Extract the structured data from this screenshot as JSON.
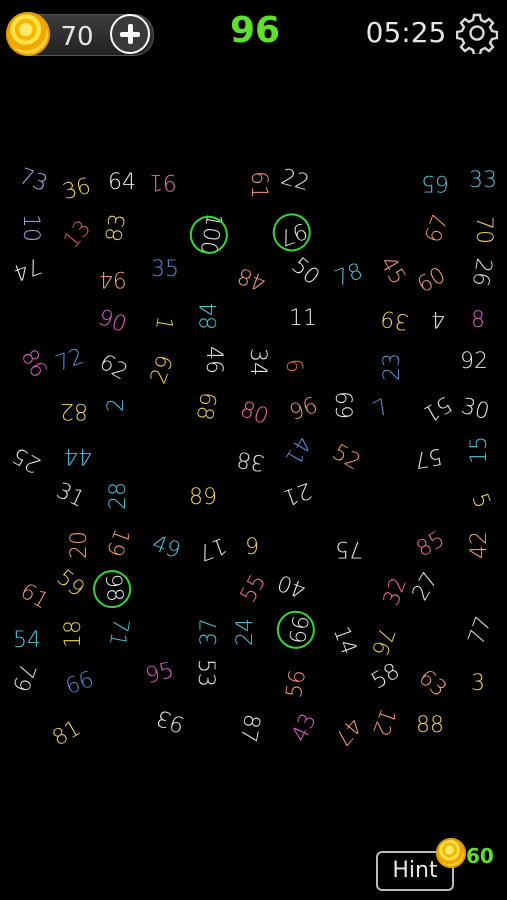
{
  "header": {
    "coins": "70",
    "add_coins_icon": "plus-icon",
    "target_number": "96",
    "timer": "05:25",
    "settings_icon": "gear-icon"
  },
  "footer": {
    "hint_label": "Hint",
    "hint_cost": "60"
  },
  "board": {
    "found_numbers": [
      "100",
      "97",
      "98",
      "99"
    ],
    "numbers": [
      {
        "value": "73",
        "color": "#b69ce8",
        "found": false
      },
      {
        "value": "36",
        "color": "#f0d060",
        "found": false
      },
      {
        "value": "64",
        "color": "#e8e8e8",
        "found": false
      },
      {
        "value": "91",
        "color": "#f06aa8",
        "found": false
      },
      {
        "value": "61",
        "color": "#f59a72",
        "found": false
      },
      {
        "value": "22",
        "color": "#e8e8e8",
        "found": false
      },
      {
        "value": "65",
        "color": "#4ec2d8",
        "found": false
      },
      {
        "value": "33",
        "color": "#4ec2d8",
        "found": false
      },
      {
        "value": "10",
        "color": "#b69ce8",
        "found": false
      },
      {
        "value": "13",
        "color": "#e04a7a",
        "found": false
      },
      {
        "value": "83",
        "color": "#f0d060",
        "found": false
      },
      {
        "value": "100",
        "color": "#e8e8e8",
        "found": true
      },
      {
        "value": "97",
        "color": "#e8e8e8",
        "found": true
      },
      {
        "value": "67",
        "color": "#f59a72",
        "found": false
      },
      {
        "value": "70",
        "color": "#f0d060",
        "found": false
      },
      {
        "value": "74",
        "color": "#e8e8e8",
        "found": false
      },
      {
        "value": "94",
        "color": "#f59a72",
        "found": false
      },
      {
        "value": "35",
        "color": "#5a8ed8",
        "found": false
      },
      {
        "value": "48",
        "color": "#f59a72",
        "found": false
      },
      {
        "value": "50",
        "color": "#e8e8e8",
        "found": false
      },
      {
        "value": "78",
        "color": "#4ec2d8",
        "found": false
      },
      {
        "value": "45",
        "color": "#f59a72",
        "found": false
      },
      {
        "value": "60",
        "color": "#f59a72",
        "found": false
      },
      {
        "value": "26",
        "color": "#e8e8e8",
        "found": false
      },
      {
        "value": "90",
        "color": "#e85ad0",
        "found": false
      },
      {
        "value": "1",
        "color": "#f0d060",
        "found": false
      },
      {
        "value": "84",
        "color": "#4ec2d8",
        "found": false
      },
      {
        "value": "11",
        "color": "#e8e8e8",
        "found": false
      },
      {
        "value": "39",
        "color": "#f0d060",
        "found": false
      },
      {
        "value": "4",
        "color": "#e8e8e8",
        "found": false
      },
      {
        "value": "8",
        "color": "#e85ad0",
        "found": false
      },
      {
        "value": "86",
        "color": "#e85ad0",
        "found": false
      },
      {
        "value": "72",
        "color": "#5a8ed8",
        "found": false
      },
      {
        "value": "62",
        "color": "#e8e8e8",
        "found": false
      },
      {
        "value": "29",
        "color": "#f0d060",
        "found": false
      },
      {
        "value": "46",
        "color": "#e8e8e8",
        "found": false
      },
      {
        "value": "34",
        "color": "#e8e8e8",
        "found": false
      },
      {
        "value": "6",
        "color": "#f06a3a",
        "found": false
      },
      {
        "value": "23",
        "color": "#5a8ed8",
        "found": false
      },
      {
        "value": "92",
        "color": "#e8e8e8",
        "found": false
      },
      {
        "value": "82",
        "color": "#f0d060",
        "found": false
      },
      {
        "value": "2",
        "color": "#4ec2d8",
        "found": false
      },
      {
        "value": "68",
        "color": "#f0d060",
        "found": false
      },
      {
        "value": "80",
        "color": "#f06aa8",
        "found": false
      },
      {
        "value": "96",
        "color": "#f59a72",
        "found": false
      },
      {
        "value": "69",
        "color": "#e8e8e8",
        "found": false
      },
      {
        "value": "7",
        "color": "#5a8ed8",
        "found": false
      },
      {
        "value": "51",
        "color": "#e8e8e8",
        "found": false
      },
      {
        "value": "30",
        "color": "#e8e8e8",
        "found": false
      },
      {
        "value": "25",
        "color": "#e8e8e8",
        "found": false
      },
      {
        "value": "44",
        "color": "#4ec2d8",
        "found": false
      },
      {
        "value": "38",
        "color": "#e8e8e8",
        "found": false
      },
      {
        "value": "41",
        "color": "#5a8ed8",
        "found": false
      },
      {
        "value": "52",
        "color": "#f59a72",
        "found": false
      },
      {
        "value": "57",
        "color": "#e8e8e8",
        "found": false
      },
      {
        "value": "15",
        "color": "#4ec2d8",
        "found": false
      },
      {
        "value": "31",
        "color": "#e8e8e8",
        "found": false
      },
      {
        "value": "28",
        "color": "#4ec2d8",
        "found": false
      },
      {
        "value": "89",
        "color": "#f0d060",
        "found": false
      },
      {
        "value": "21",
        "color": "#e8e8e8",
        "found": false
      },
      {
        "value": "5",
        "color": "#f0d060",
        "found": false
      },
      {
        "value": "20",
        "color": "#f59a72",
        "found": false
      },
      {
        "value": "19",
        "color": "#f59a72",
        "found": false
      },
      {
        "value": "49",
        "color": "#4ec2d8",
        "found": false
      },
      {
        "value": "17",
        "color": "#e8e8e8",
        "found": false
      },
      {
        "value": "9",
        "color": "#f0d060",
        "found": false
      },
      {
        "value": "75",
        "color": "#e8e8e8",
        "found": false
      },
      {
        "value": "85",
        "color": "#f06aa8",
        "found": false
      },
      {
        "value": "42",
        "color": "#f59a72",
        "found": false
      },
      {
        "value": "61",
        "color": "#f59a72",
        "found": false
      },
      {
        "value": "59",
        "color": "#f0d060",
        "found": false
      },
      {
        "value": "98",
        "color": "#e8e8e8",
        "found": true
      },
      {
        "value": "55",
        "color": "#f06aa8",
        "found": false
      },
      {
        "value": "40",
        "color": "#e8e8e8",
        "found": false
      },
      {
        "value": "32",
        "color": "#f06aa8",
        "found": false
      },
      {
        "value": "27",
        "color": "#e8e8e8",
        "found": false
      },
      {
        "value": "54",
        "color": "#4ec2d8",
        "found": false
      },
      {
        "value": "18",
        "color": "#f0d060",
        "found": false
      },
      {
        "value": "71",
        "color": "#4ec2d8",
        "found": false
      },
      {
        "value": "37",
        "color": "#4ec2d8",
        "found": false
      },
      {
        "value": "24",
        "color": "#4ec2d8",
        "found": false
      },
      {
        "value": "99",
        "color": "#e8e8e8",
        "found": true
      },
      {
        "value": "14",
        "color": "#e8e8e8",
        "found": false
      },
      {
        "value": "76",
        "color": "#f0d060",
        "found": false
      },
      {
        "value": "77",
        "color": "#e8e8e8",
        "found": false
      },
      {
        "value": "79",
        "color": "#e8e8e8",
        "found": false
      },
      {
        "value": "66",
        "color": "#5a8ed8",
        "found": false
      },
      {
        "value": "95",
        "color": "#e85ad0",
        "found": false
      },
      {
        "value": "53",
        "color": "#e8e8e8",
        "found": false
      },
      {
        "value": "56",
        "color": "#f59a72",
        "found": false
      },
      {
        "value": "58",
        "color": "#e8e8e8",
        "found": false
      },
      {
        "value": "63",
        "color": "#f59a72",
        "found": false
      },
      {
        "value": "3",
        "color": "#f0d060",
        "found": false
      },
      {
        "value": "81",
        "color": "#f0d060",
        "found": false
      },
      {
        "value": "93",
        "color": "#e8e8e8",
        "found": false
      },
      {
        "value": "87",
        "color": "#e8e8e8",
        "found": false
      },
      {
        "value": "43",
        "color": "#e85ad0",
        "found": false
      },
      {
        "value": "47",
        "color": "#f59a72",
        "found": false
      },
      {
        "value": "12",
        "color": "#f59a72",
        "found": false
      },
      {
        "value": "88",
        "color": "#f0d060",
        "found": false
      }
    ]
  }
}
